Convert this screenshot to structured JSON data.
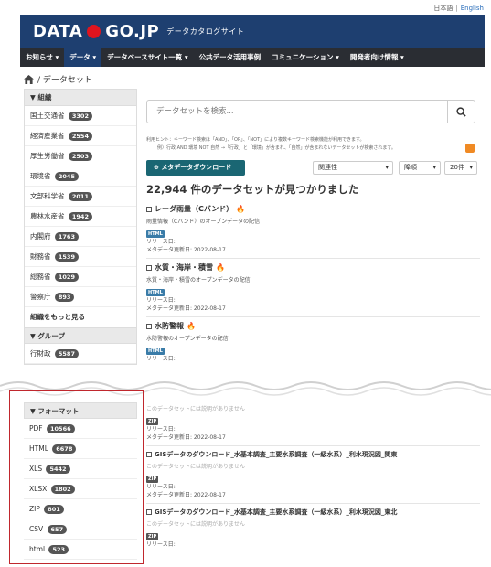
{
  "lang": {
    "ja": "日本語",
    "en": "English"
  },
  "header": {
    "logo_left": "DATA",
    "logo_right": "GO.JP",
    "subtitle": "データカタログサイト"
  },
  "nav": [
    "お知らせ ▾",
    "データ ▾",
    "データベースサイト一覧 ▾",
    "公共データ活用事例",
    "コミュニケーション ▾",
    "開発者向け情報 ▾"
  ],
  "breadcrumb": "/ データセット",
  "sidebar": {
    "org_heading": "組織",
    "orgs": [
      {
        "name": "国土交通省",
        "count": "3302"
      },
      {
        "name": "経済産業省",
        "count": "2554"
      },
      {
        "name": "厚生労働省",
        "count": "2503"
      },
      {
        "name": "環境省",
        "count": "2045"
      },
      {
        "name": "文部科学省",
        "count": "2011"
      },
      {
        "name": "農林水産省",
        "count": "1942"
      },
      {
        "name": "内閣府",
        "count": "1763"
      },
      {
        "name": "財務省",
        "count": "1539"
      },
      {
        "name": "総務省",
        "count": "1029"
      },
      {
        "name": "警察庁",
        "count": "893"
      }
    ],
    "org_more": "組織をもっと見る",
    "group_heading": "グループ",
    "groups": [
      {
        "name": "行財政",
        "count": "5587"
      }
    ],
    "format_heading": "フォーマット",
    "formats": [
      {
        "name": "PDF",
        "count": "10566"
      },
      {
        "name": "HTML",
        "count": "6678"
      },
      {
        "name": "XLS",
        "count": "5442"
      },
      {
        "name": "XLSX",
        "count": "1802"
      },
      {
        "name": "ZIP",
        "count": "801"
      },
      {
        "name": "CSV",
        "count": "657"
      },
      {
        "name": "html",
        "count": "523"
      }
    ]
  },
  "search": {
    "placeholder": "データセットを検索..."
  },
  "hint": {
    "line1": "利用ヒント：キーワード検索は「AND」、「OR」、「NOT」により複数キーワード検索機能が利用できます。",
    "line2": "例）行政 AND 環境 NOT 自然 →「行政」と「環境」が含まれ、「自然」が含まれないデータセットが検索されます。"
  },
  "download_button": "メタデータダウンロード",
  "sort": {
    "order": "関連性",
    "direction": "降順",
    "per_page": "20件"
  },
  "result_count": "22,944 件のデータセットが見つかりました",
  "datasets_top": [
    {
      "title": "レーダ雨量（Cバンド）",
      "desc": "雨量情報（Cバンド）のオープンデータの配信",
      "format": "HTML",
      "release": "リリース日:",
      "updated": "メタデータ更新日: 2022-08-17"
    },
    {
      "title": "水質・海岸・積雪",
      "desc": "水質・海岸・積雪のオープンデータの配信",
      "format": "HTML",
      "release": "リリース日:",
      "updated": "メタデータ更新日: 2022-08-17"
    },
    {
      "title": "水防警報",
      "desc": "水防警報のオープンデータの配信",
      "format": "HTML",
      "release": "リリース日:",
      "updated": "メタデータ更新日: 2022-08-17"
    }
  ],
  "datasets_bottom": [
    {
      "nodesc": "このデータセットには説明がありません",
      "format": "ZIP",
      "release": "リリース日:",
      "updated": "メタデータ更新日: 2022-08-17"
    },
    {
      "title": "GISデータのダウンロード_水基本調査_主要水系調査（一級水系）_利水現況図_関東",
      "nodesc": "このデータセットには説明がありません",
      "format": "ZIP",
      "release": "リリース日:",
      "updated": "メタデータ更新日: 2022-08-17"
    },
    {
      "title": "GISデータのダウンロード_水基本調査_主要水系調査（一級水系）_利水現況図_東北",
      "nodesc": "このデータセットには説明がありません",
      "format": "ZIP",
      "release": "リリース日:"
    }
  ],
  "colors": {
    "header": "#1e3f70",
    "nav": "#2a2d33",
    "button": "#1a6673",
    "highlight_box": "#c0272d"
  }
}
